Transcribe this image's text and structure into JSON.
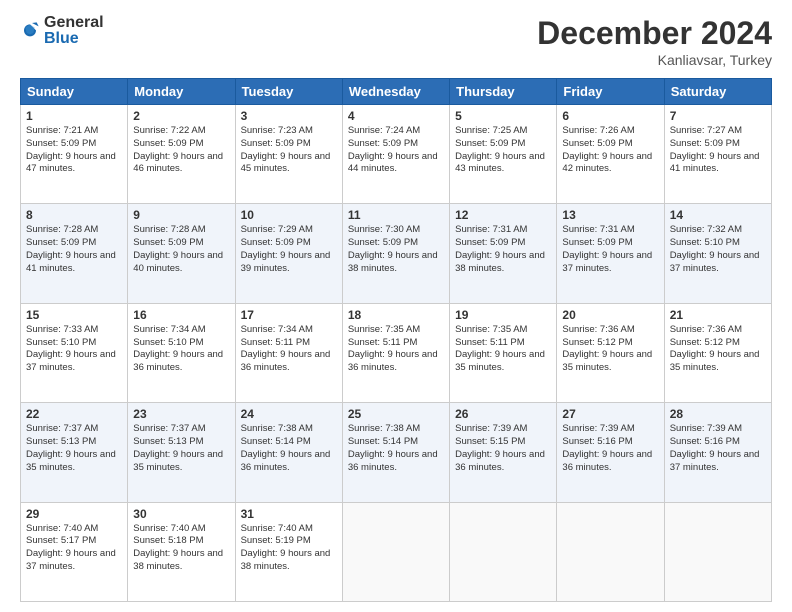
{
  "logo": {
    "general": "General",
    "blue": "Blue"
  },
  "header": {
    "month": "December 2024",
    "location": "Kanliavsar, Turkey"
  },
  "weekdays": [
    "Sunday",
    "Monday",
    "Tuesday",
    "Wednesday",
    "Thursday",
    "Friday",
    "Saturday"
  ],
  "weeks": [
    [
      {
        "day": "1",
        "sunrise": "7:21 AM",
        "sunset": "5:09 PM",
        "daylight": "9 hours and 47 minutes."
      },
      {
        "day": "2",
        "sunrise": "7:22 AM",
        "sunset": "5:09 PM",
        "daylight": "9 hours and 46 minutes."
      },
      {
        "day": "3",
        "sunrise": "7:23 AM",
        "sunset": "5:09 PM",
        "daylight": "9 hours and 45 minutes."
      },
      {
        "day": "4",
        "sunrise": "7:24 AM",
        "sunset": "5:09 PM",
        "daylight": "9 hours and 44 minutes."
      },
      {
        "day": "5",
        "sunrise": "7:25 AM",
        "sunset": "5:09 PM",
        "daylight": "9 hours and 43 minutes."
      },
      {
        "day": "6",
        "sunrise": "7:26 AM",
        "sunset": "5:09 PM",
        "daylight": "9 hours and 42 minutes."
      },
      {
        "day": "7",
        "sunrise": "7:27 AM",
        "sunset": "5:09 PM",
        "daylight": "9 hours and 41 minutes."
      }
    ],
    [
      {
        "day": "8",
        "sunrise": "7:28 AM",
        "sunset": "5:09 PM",
        "daylight": "9 hours and 41 minutes."
      },
      {
        "day": "9",
        "sunrise": "7:28 AM",
        "sunset": "5:09 PM",
        "daylight": "9 hours and 40 minutes."
      },
      {
        "day": "10",
        "sunrise": "7:29 AM",
        "sunset": "5:09 PM",
        "daylight": "9 hours and 39 minutes."
      },
      {
        "day": "11",
        "sunrise": "7:30 AM",
        "sunset": "5:09 PM",
        "daylight": "9 hours and 38 minutes."
      },
      {
        "day": "12",
        "sunrise": "7:31 AM",
        "sunset": "5:09 PM",
        "daylight": "9 hours and 38 minutes."
      },
      {
        "day": "13",
        "sunrise": "7:31 AM",
        "sunset": "5:09 PM",
        "daylight": "9 hours and 37 minutes."
      },
      {
        "day": "14",
        "sunrise": "7:32 AM",
        "sunset": "5:10 PM",
        "daylight": "9 hours and 37 minutes."
      }
    ],
    [
      {
        "day": "15",
        "sunrise": "7:33 AM",
        "sunset": "5:10 PM",
        "daylight": "9 hours and 37 minutes."
      },
      {
        "day": "16",
        "sunrise": "7:34 AM",
        "sunset": "5:10 PM",
        "daylight": "9 hours and 36 minutes."
      },
      {
        "day": "17",
        "sunrise": "7:34 AM",
        "sunset": "5:11 PM",
        "daylight": "9 hours and 36 minutes."
      },
      {
        "day": "18",
        "sunrise": "7:35 AM",
        "sunset": "5:11 PM",
        "daylight": "9 hours and 36 minutes."
      },
      {
        "day": "19",
        "sunrise": "7:35 AM",
        "sunset": "5:11 PM",
        "daylight": "9 hours and 35 minutes."
      },
      {
        "day": "20",
        "sunrise": "7:36 AM",
        "sunset": "5:12 PM",
        "daylight": "9 hours and 35 minutes."
      },
      {
        "day": "21",
        "sunrise": "7:36 AM",
        "sunset": "5:12 PM",
        "daylight": "9 hours and 35 minutes."
      }
    ],
    [
      {
        "day": "22",
        "sunrise": "7:37 AM",
        "sunset": "5:13 PM",
        "daylight": "9 hours and 35 minutes."
      },
      {
        "day": "23",
        "sunrise": "7:37 AM",
        "sunset": "5:13 PM",
        "daylight": "9 hours and 35 minutes."
      },
      {
        "day": "24",
        "sunrise": "7:38 AM",
        "sunset": "5:14 PM",
        "daylight": "9 hours and 36 minutes."
      },
      {
        "day": "25",
        "sunrise": "7:38 AM",
        "sunset": "5:14 PM",
        "daylight": "9 hours and 36 minutes."
      },
      {
        "day": "26",
        "sunrise": "7:39 AM",
        "sunset": "5:15 PM",
        "daylight": "9 hours and 36 minutes."
      },
      {
        "day": "27",
        "sunrise": "7:39 AM",
        "sunset": "5:16 PM",
        "daylight": "9 hours and 36 minutes."
      },
      {
        "day": "28",
        "sunrise": "7:39 AM",
        "sunset": "5:16 PM",
        "daylight": "9 hours and 37 minutes."
      }
    ],
    [
      {
        "day": "29",
        "sunrise": "7:40 AM",
        "sunset": "5:17 PM",
        "daylight": "9 hours and 37 minutes."
      },
      {
        "day": "30",
        "sunrise": "7:40 AM",
        "sunset": "5:18 PM",
        "daylight": "9 hours and 38 minutes."
      },
      {
        "day": "31",
        "sunrise": "7:40 AM",
        "sunset": "5:19 PM",
        "daylight": "9 hours and 38 minutes."
      },
      null,
      null,
      null,
      null
    ]
  ]
}
